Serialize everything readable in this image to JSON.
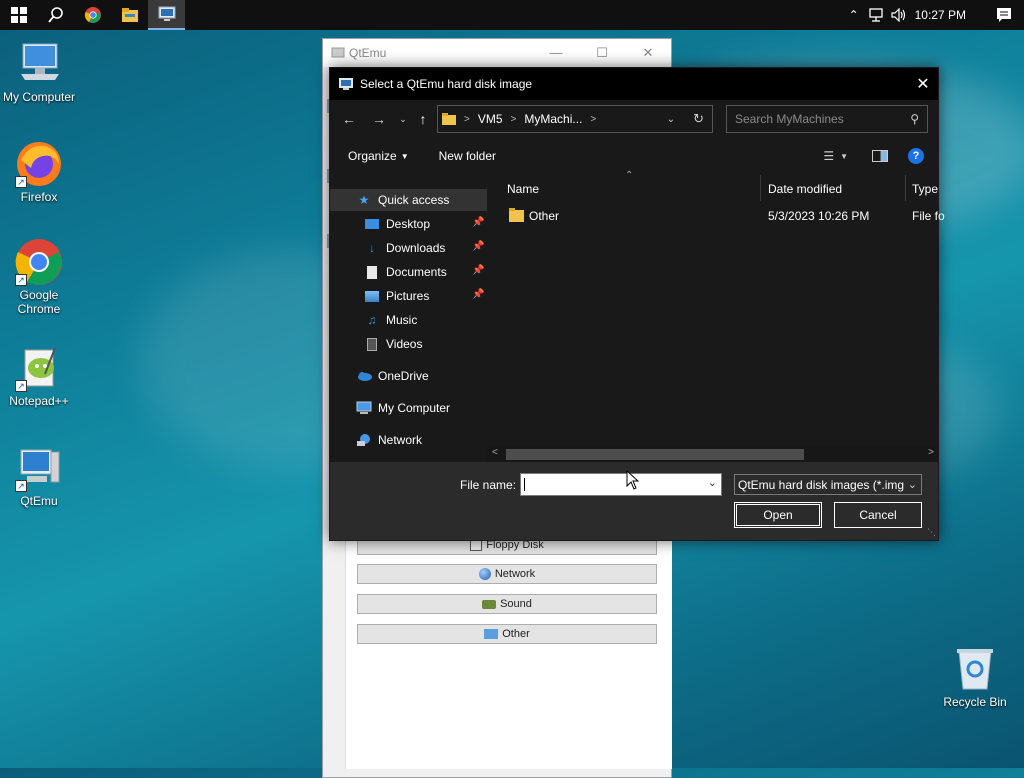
{
  "taskbar": {
    "clock": "10:27 PM"
  },
  "desktop": {
    "icons": [
      {
        "label": "My Computer"
      },
      {
        "label": "Firefox"
      },
      {
        "label": "Google Chrome"
      },
      {
        "label": "Notepad++"
      },
      {
        "label": "QtEmu"
      },
      {
        "label": "Recycle Bin"
      }
    ]
  },
  "qtemu_window": {
    "title": "QtEmu",
    "buttons": [
      "Floppy Disk",
      "Network",
      "Sound",
      "Other"
    ]
  },
  "dialog": {
    "title": "Select a QtEmu hard disk image",
    "address": [
      "VM5",
      "MyMachi..."
    ],
    "search_placeholder": "Search MyMachines",
    "toolbar": {
      "organize": "Organize",
      "new_folder": "New folder"
    },
    "sidebar": {
      "quick_access": "Quick access",
      "items": [
        "Desktop",
        "Downloads",
        "Documents",
        "Pictures",
        "Music",
        "Videos"
      ],
      "onedrive": "OneDrive",
      "my_computer": "My Computer",
      "network": "Network"
    },
    "columns": {
      "name": "Name",
      "date": "Date modified",
      "type": "Type"
    },
    "files": [
      {
        "name": "Other",
        "date": "5/3/2023 10:26 PM",
        "type": "File fo"
      }
    ],
    "file_name_label": "File name:",
    "file_name_value": "",
    "file_type": "QtEmu hard disk images (*.img",
    "open_label": "Open",
    "cancel_label": "Cancel"
  }
}
